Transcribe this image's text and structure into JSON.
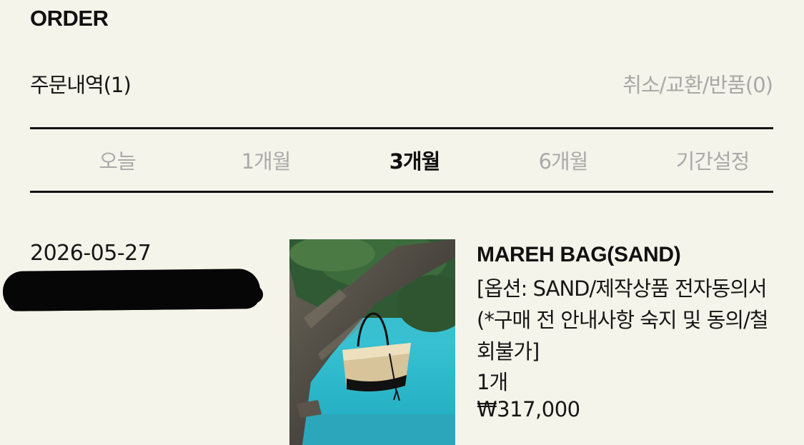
{
  "header": {
    "title": "ORDER"
  },
  "summary": {
    "order_history": "주문내역(1)",
    "cancel_exchange_return": "취소/교환/반품(0)"
  },
  "period_tabs": [
    {
      "label": "오늘",
      "active": false
    },
    {
      "label": "1개월",
      "active": false
    },
    {
      "label": "3개월",
      "active": true
    },
    {
      "label": "6개월",
      "active": false
    },
    {
      "label": "기간설정",
      "active": false
    }
  ],
  "orders": [
    {
      "date": "2026-05-27",
      "product": {
        "image_icon": "product-photo-tote-bag-on-tree",
        "name": "MAREH BAG(SAND)",
        "option": "[옵션: SAND/제작상품 전자동의서(*구매 전 안내사항 숙지 및 동의/철회불가]",
        "quantity": "1개",
        "price": "₩317,000"
      }
    }
  ],
  "colors": {
    "background": "#f5f4ea",
    "text": "#111111",
    "muted": "#aaaaaa"
  }
}
